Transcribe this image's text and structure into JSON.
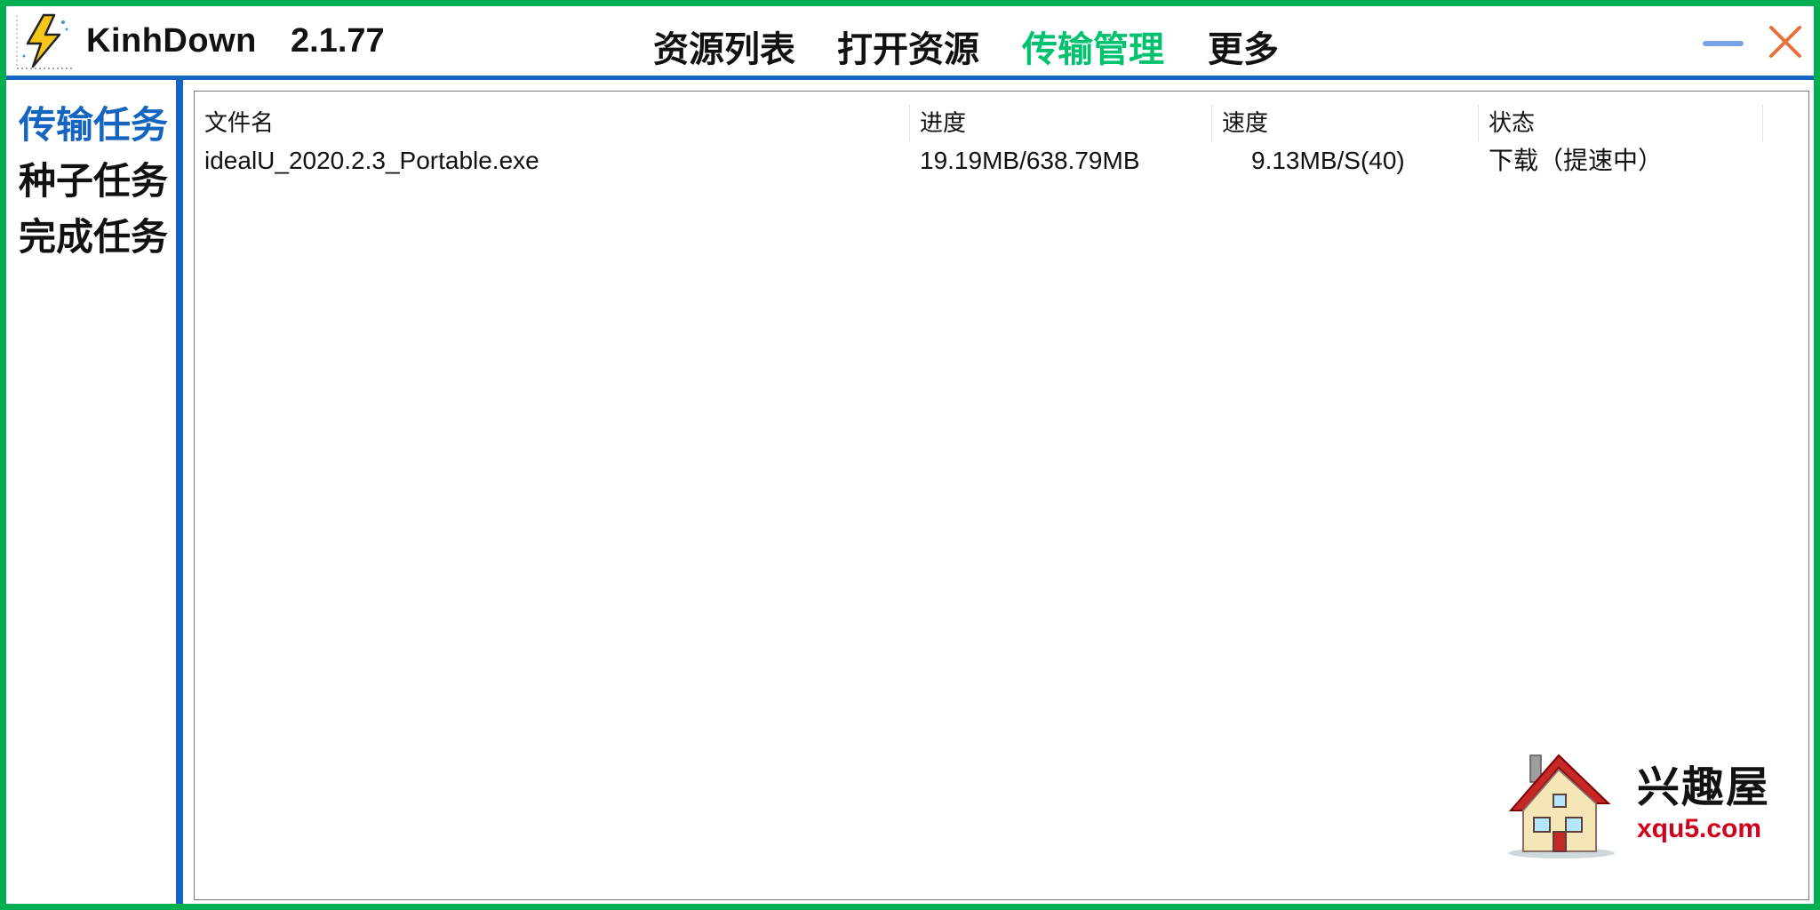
{
  "app": {
    "name": "KinhDown",
    "version": "2.1.77",
    "icon": "lightning-bolt-icon"
  },
  "nav": [
    {
      "label": "资源列表",
      "active": false
    },
    {
      "label": "打开资源",
      "active": false
    },
    {
      "label": "传输管理",
      "active": true
    },
    {
      "label": "更多",
      "active": false
    }
  ],
  "window_controls": {
    "minimize": "minimize-icon",
    "close": "close-icon"
  },
  "sidebar": {
    "items": [
      {
        "label": "传输任务",
        "active": true
      },
      {
        "label": "种子任务",
        "active": false
      },
      {
        "label": "完成任务",
        "active": false
      }
    ]
  },
  "table": {
    "columns": [
      "文件名",
      "进度",
      "速度",
      "状态"
    ],
    "rows": [
      {
        "filename": "idealU_2020.2.3_Portable.exe",
        "progress": "19.19MB/638.79MB",
        "speed": "9.13MB/S(40)",
        "status": "下载（提速中）"
      }
    ]
  },
  "watermark": {
    "brand": "兴趣屋",
    "url": "xqu5.com",
    "icon": "house-icon"
  },
  "colors": {
    "frame_green": "#00b050",
    "accent_blue": "#1565c0",
    "active_nav_green": "#00c16e",
    "close_orange": "#e8703a",
    "minimize_blue": "#7aa3e5"
  }
}
